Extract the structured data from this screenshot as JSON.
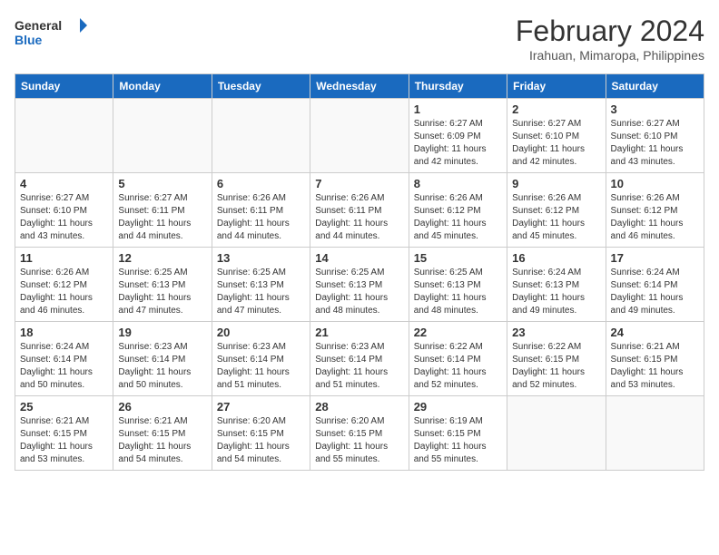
{
  "header": {
    "logo_text_general": "General",
    "logo_text_blue": "Blue",
    "month_year": "February 2024",
    "location": "Irahuan, Mimaropa, Philippines"
  },
  "weekdays": [
    "Sunday",
    "Monday",
    "Tuesday",
    "Wednesday",
    "Thursday",
    "Friday",
    "Saturday"
  ],
  "weeks": [
    [
      {
        "day": "",
        "info": ""
      },
      {
        "day": "",
        "info": ""
      },
      {
        "day": "",
        "info": ""
      },
      {
        "day": "",
        "info": ""
      },
      {
        "day": "1",
        "info": "Sunrise: 6:27 AM\nSunset: 6:09 PM\nDaylight: 11 hours and 42 minutes."
      },
      {
        "day": "2",
        "info": "Sunrise: 6:27 AM\nSunset: 6:10 PM\nDaylight: 11 hours and 42 minutes."
      },
      {
        "day": "3",
        "info": "Sunrise: 6:27 AM\nSunset: 6:10 PM\nDaylight: 11 hours and 43 minutes."
      }
    ],
    [
      {
        "day": "4",
        "info": "Sunrise: 6:27 AM\nSunset: 6:10 PM\nDaylight: 11 hours and 43 minutes."
      },
      {
        "day": "5",
        "info": "Sunrise: 6:27 AM\nSunset: 6:11 PM\nDaylight: 11 hours and 44 minutes."
      },
      {
        "day": "6",
        "info": "Sunrise: 6:26 AM\nSunset: 6:11 PM\nDaylight: 11 hours and 44 minutes."
      },
      {
        "day": "7",
        "info": "Sunrise: 6:26 AM\nSunset: 6:11 PM\nDaylight: 11 hours and 44 minutes."
      },
      {
        "day": "8",
        "info": "Sunrise: 6:26 AM\nSunset: 6:12 PM\nDaylight: 11 hours and 45 minutes."
      },
      {
        "day": "9",
        "info": "Sunrise: 6:26 AM\nSunset: 6:12 PM\nDaylight: 11 hours and 45 minutes."
      },
      {
        "day": "10",
        "info": "Sunrise: 6:26 AM\nSunset: 6:12 PM\nDaylight: 11 hours and 46 minutes."
      }
    ],
    [
      {
        "day": "11",
        "info": "Sunrise: 6:26 AM\nSunset: 6:12 PM\nDaylight: 11 hours and 46 minutes."
      },
      {
        "day": "12",
        "info": "Sunrise: 6:25 AM\nSunset: 6:13 PM\nDaylight: 11 hours and 47 minutes."
      },
      {
        "day": "13",
        "info": "Sunrise: 6:25 AM\nSunset: 6:13 PM\nDaylight: 11 hours and 47 minutes."
      },
      {
        "day": "14",
        "info": "Sunrise: 6:25 AM\nSunset: 6:13 PM\nDaylight: 11 hours and 48 minutes."
      },
      {
        "day": "15",
        "info": "Sunrise: 6:25 AM\nSunset: 6:13 PM\nDaylight: 11 hours and 48 minutes."
      },
      {
        "day": "16",
        "info": "Sunrise: 6:24 AM\nSunset: 6:13 PM\nDaylight: 11 hours and 49 minutes."
      },
      {
        "day": "17",
        "info": "Sunrise: 6:24 AM\nSunset: 6:14 PM\nDaylight: 11 hours and 49 minutes."
      }
    ],
    [
      {
        "day": "18",
        "info": "Sunrise: 6:24 AM\nSunset: 6:14 PM\nDaylight: 11 hours and 50 minutes."
      },
      {
        "day": "19",
        "info": "Sunrise: 6:23 AM\nSunset: 6:14 PM\nDaylight: 11 hours and 50 minutes."
      },
      {
        "day": "20",
        "info": "Sunrise: 6:23 AM\nSunset: 6:14 PM\nDaylight: 11 hours and 51 minutes."
      },
      {
        "day": "21",
        "info": "Sunrise: 6:23 AM\nSunset: 6:14 PM\nDaylight: 11 hours and 51 minutes."
      },
      {
        "day": "22",
        "info": "Sunrise: 6:22 AM\nSunset: 6:14 PM\nDaylight: 11 hours and 52 minutes."
      },
      {
        "day": "23",
        "info": "Sunrise: 6:22 AM\nSunset: 6:15 PM\nDaylight: 11 hours and 52 minutes."
      },
      {
        "day": "24",
        "info": "Sunrise: 6:21 AM\nSunset: 6:15 PM\nDaylight: 11 hours and 53 minutes."
      }
    ],
    [
      {
        "day": "25",
        "info": "Sunrise: 6:21 AM\nSunset: 6:15 PM\nDaylight: 11 hours and 53 minutes."
      },
      {
        "day": "26",
        "info": "Sunrise: 6:21 AM\nSunset: 6:15 PM\nDaylight: 11 hours and 54 minutes."
      },
      {
        "day": "27",
        "info": "Sunrise: 6:20 AM\nSunset: 6:15 PM\nDaylight: 11 hours and 54 minutes."
      },
      {
        "day": "28",
        "info": "Sunrise: 6:20 AM\nSunset: 6:15 PM\nDaylight: 11 hours and 55 minutes."
      },
      {
        "day": "29",
        "info": "Sunrise: 6:19 AM\nSunset: 6:15 PM\nDaylight: 11 hours and 55 minutes."
      },
      {
        "day": "",
        "info": ""
      },
      {
        "day": "",
        "info": ""
      }
    ]
  ]
}
